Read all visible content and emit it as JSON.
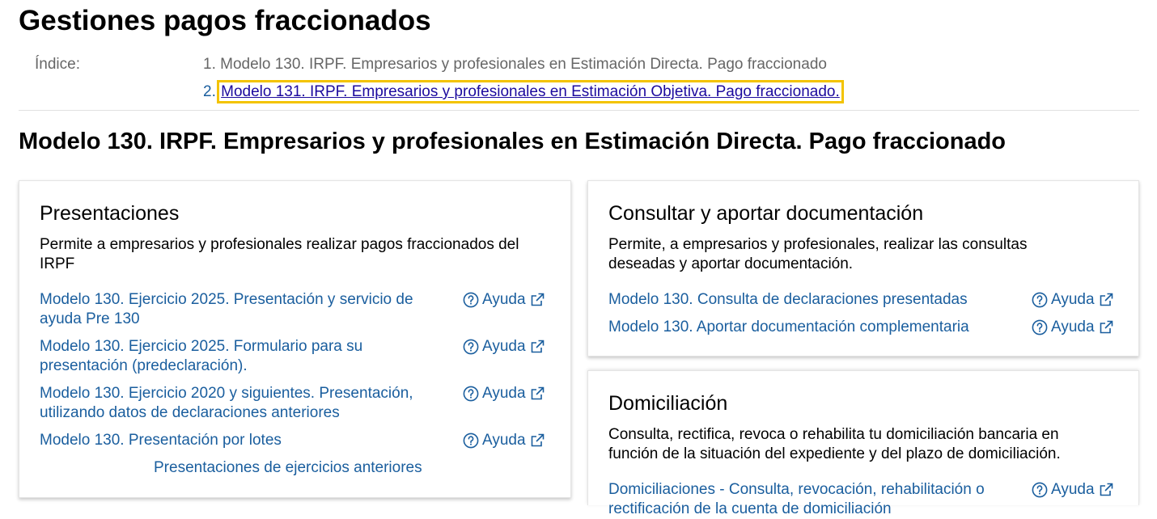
{
  "page": {
    "title": "Gestiones pagos fraccionados"
  },
  "index": {
    "label": "Índice:",
    "items": [
      {
        "number": "1.",
        "label": "Modelo 130. IRPF. Empresarios y profesionales en Estimación Directa. Pago fraccionado"
      },
      {
        "number": "2.",
        "label": "Modelo 131. IRPF. Empresarios y profesionales en Estimación Objetiva. Pago fraccionado."
      }
    ]
  },
  "section": {
    "title": "Modelo 130. IRPF. Empresarios y profesionales en Estimación Directa. Pago fraccionado"
  },
  "help_label": "Ayuda",
  "cards": {
    "presentaciones": {
      "title": "Presentaciones",
      "description": "Permite a empresarios y profesionales realizar pagos fraccionados del IRPF",
      "links": [
        "Modelo 130. Ejercicio 2025. Presentación y servicio de ayuda Pre 130",
        "Modelo 130. Ejercicio 2025. Formulario para su presentación (predeclaración).",
        "Modelo 130. Ejercicio 2020 y siguientes. Presentación, utilizando datos de declaraciones anteriores",
        "Modelo 130. Presentación por lotes"
      ],
      "footer_link": "Presentaciones de ejercicios anteriores"
    },
    "consultar": {
      "title": "Consultar y aportar documentación",
      "description": "Permite, a empresarios y profesionales, realizar las consultas deseadas y aportar documentación.",
      "links": [
        "Modelo 130. Consulta de declaraciones presentadas",
        "Modelo 130. Aportar documentación complementaria"
      ]
    },
    "domiciliacion": {
      "title": "Domiciliación",
      "description": "Consulta, rectifica, revoca o rehabilita tu domiciliación bancaria en función de la situación del expediente y del plazo de domiciliación.",
      "links": [
        "Domiciliaciones - Consulta, revocación, rehabilitación o rectificación de la cuenta de domiciliación"
      ]
    }
  },
  "colors": {
    "link": "#1a5e9e",
    "focus_outline": "#f3c300",
    "visited_link": "#1c0a9e"
  }
}
